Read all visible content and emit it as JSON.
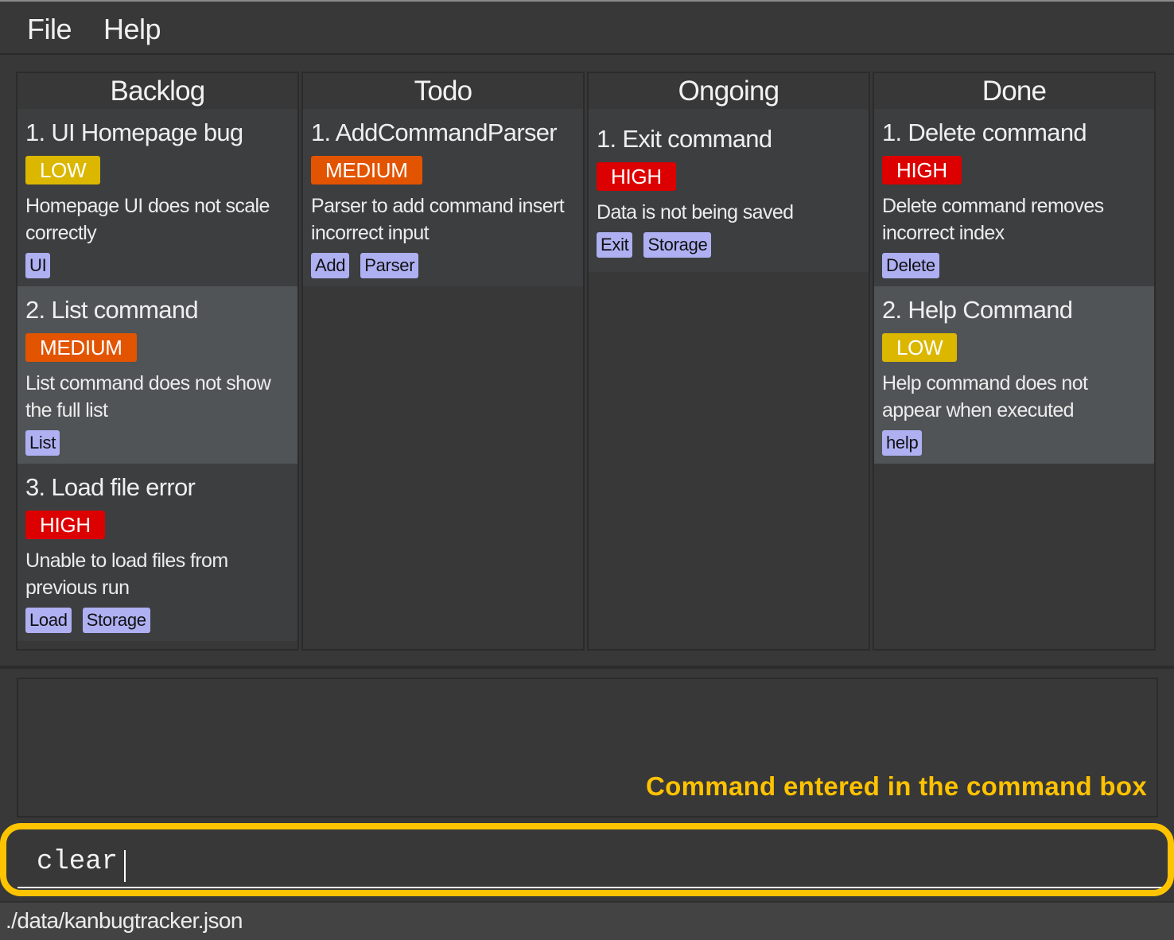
{
  "menu": {
    "items": [
      "File",
      "Help"
    ]
  },
  "board": {
    "columns": [
      {
        "title": "Backlog",
        "cards": [
          {
            "title": "1. UI Homepage bug",
            "priority": "LOW",
            "description": "Homepage UI does not scale correctly",
            "tags": [
              "UI"
            ]
          },
          {
            "title": "2. List command",
            "priority": "MEDIUM",
            "description": "List command does not show the full list",
            "tags": [
              "List"
            ]
          },
          {
            "title": "3. Load file error",
            "priority": "HIGH",
            "description": "Unable to load files from previous run",
            "tags": [
              "Load",
              "Storage"
            ]
          }
        ]
      },
      {
        "title": "Todo",
        "cards": [
          {
            "title": "1. AddCommandParser",
            "priority": "MEDIUM",
            "description": "Parser to add command insert incorrect input",
            "tags": [
              "Add",
              "Parser"
            ]
          }
        ]
      },
      {
        "title": "Ongoing",
        "cards": [
          {
            "title": "1. Exit command",
            "priority": "HIGH",
            "description": "Data is not being saved",
            "tags": [
              "Exit",
              "Storage"
            ]
          }
        ]
      },
      {
        "title": "Done",
        "cards": [
          {
            "title": "1. Delete command",
            "priority": "HIGH",
            "description": "Delete command removes incorrect index",
            "tags": [
              "Delete"
            ]
          },
          {
            "title": "2. Help Command",
            "priority": "LOW",
            "description": "Help command does not appear when executed",
            "tags": [
              "help"
            ]
          }
        ]
      }
    ]
  },
  "result": {
    "text": "",
    "annotation": "Command entered in the command box"
  },
  "command": {
    "value": "clear",
    "placeholder": ""
  },
  "status": {
    "file_path": "./data/kanbugtracker.json"
  },
  "colors": {
    "priority_low": "#dbb700",
    "priority_medium": "#e35400",
    "priority_high": "#dc0000",
    "tag": "#aeb0f2",
    "annotation": "#ffc200"
  }
}
